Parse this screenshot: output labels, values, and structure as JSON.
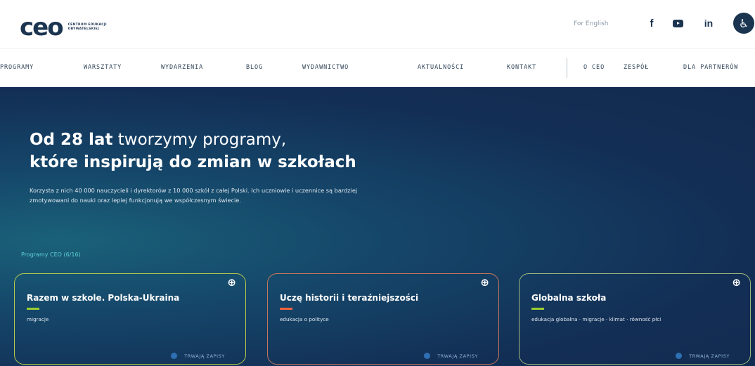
{
  "header": {
    "logo_text": "ceo",
    "logo_sub": "CENTRUM EDUKACJI OBYWATELSKIEJ",
    "lang_link": "For English",
    "social": [
      {
        "name": "facebook-icon",
        "glyph": "f"
      },
      {
        "name": "youtube-icon",
        "glyph": ""
      },
      {
        "name": "linkedin-icon",
        "glyph": "in"
      }
    ],
    "accessibility_glyph": "♿"
  },
  "nav": {
    "items": [
      "PROGRAMY",
      "WARSZTATY",
      "WYDARZENIA",
      "BLOG",
      "WYDAWNICTWO",
      "AKTUALNOŚCI",
      "KONTAKT",
      "O CEO",
      "ZESPÓŁ",
      "DLA PARTNERÓW"
    ]
  },
  "hero": {
    "title_bold": "Od 28 lat",
    "title_rest": " tworzymy programy,",
    "title_line2": "które inspirują do zmian w szkołach",
    "description": "Korzysta z nich 40 000 nauczycieli i dyrektorów z 10 000 szkół z całej Polski. Ich uczniowie i uczennice są bardziej zmotywowani do nauki oraz lepiej funkcjonują we współczesnym świecie.",
    "programs_count": "Programy CEO (6/16)"
  },
  "cards": [
    {
      "title": "Razem w szkole. Polska-Ukraina",
      "tags": "migracje",
      "status": "TRWAJĄ ZAPISY",
      "accent": "#9acd32",
      "frame": "#b7c94a"
    },
    {
      "title": "Uczę historii i teraźniejszości",
      "tags": "edukacja o polityce",
      "status": "TRWAJĄ ZAPISY",
      "accent": "#f0643c",
      "frame": "#c8765a"
    },
    {
      "title": "Globalna szkoła",
      "tags": "edukacja globalna · migracje · klimat · równość płci",
      "status": "TRWAJĄ ZAPISY",
      "accent": "#9acd32",
      "frame": "#9fb87c"
    }
  ]
}
